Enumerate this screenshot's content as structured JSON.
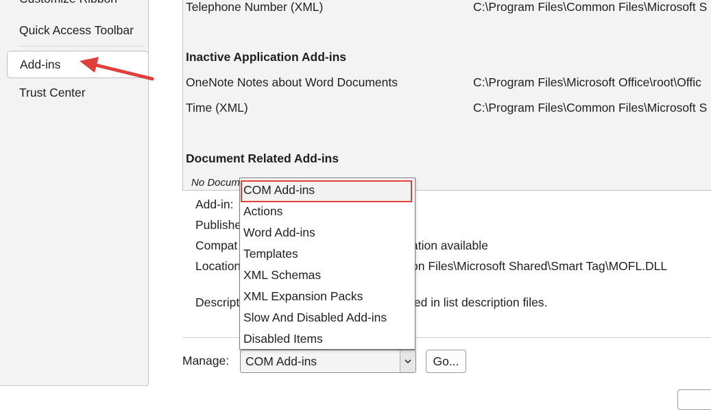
{
  "nav": {
    "items": [
      {
        "label": "Customize Ribbon"
      },
      {
        "label": "Quick Access Toolbar"
      },
      {
        "label": "Add-ins"
      },
      {
        "label": "Trust Center"
      }
    ]
  },
  "addins": {
    "rows": [
      {
        "name": "Telephone Number (XML)",
        "location": "C:\\Program Files\\Common Files\\Microsoft S"
      }
    ],
    "inactive": {
      "heading": "Inactive Application Add-ins",
      "rows": [
        {
          "name": "OneNote Notes about Word Documents",
          "location": "C:\\Program Files\\Microsoft Office\\root\\Offic"
        },
        {
          "name": "Time (XML)",
          "location": "C:\\Program Files\\Common Files\\Microsoft S"
        }
      ]
    },
    "document": {
      "heading": "Document Related Add-ins",
      "empty_text": "No Docum"
    }
  },
  "details": {
    "addin_label": "Add-in:",
    "publisher_label": "Publishe",
    "compat_label": "Compat",
    "compat_value": "ation available",
    "location_label": "Location",
    "location_value": "on Files\\Microsoft Shared\\Smart Tag\\MOFL.DLL",
    "description_label": "Descript",
    "description_value": "ied in list description files."
  },
  "manage": {
    "label": "Manage:",
    "selected": "COM Add-ins",
    "go_label": "Go...",
    "options": [
      "COM Add-ins",
      "Actions",
      "Word Add-ins",
      "Templates",
      "XML Schemas",
      "XML Expansion Packs",
      "Slow And Disabled Add-ins",
      "Disabled Items"
    ]
  },
  "colors": {
    "annotation_red": "#e0403a"
  }
}
